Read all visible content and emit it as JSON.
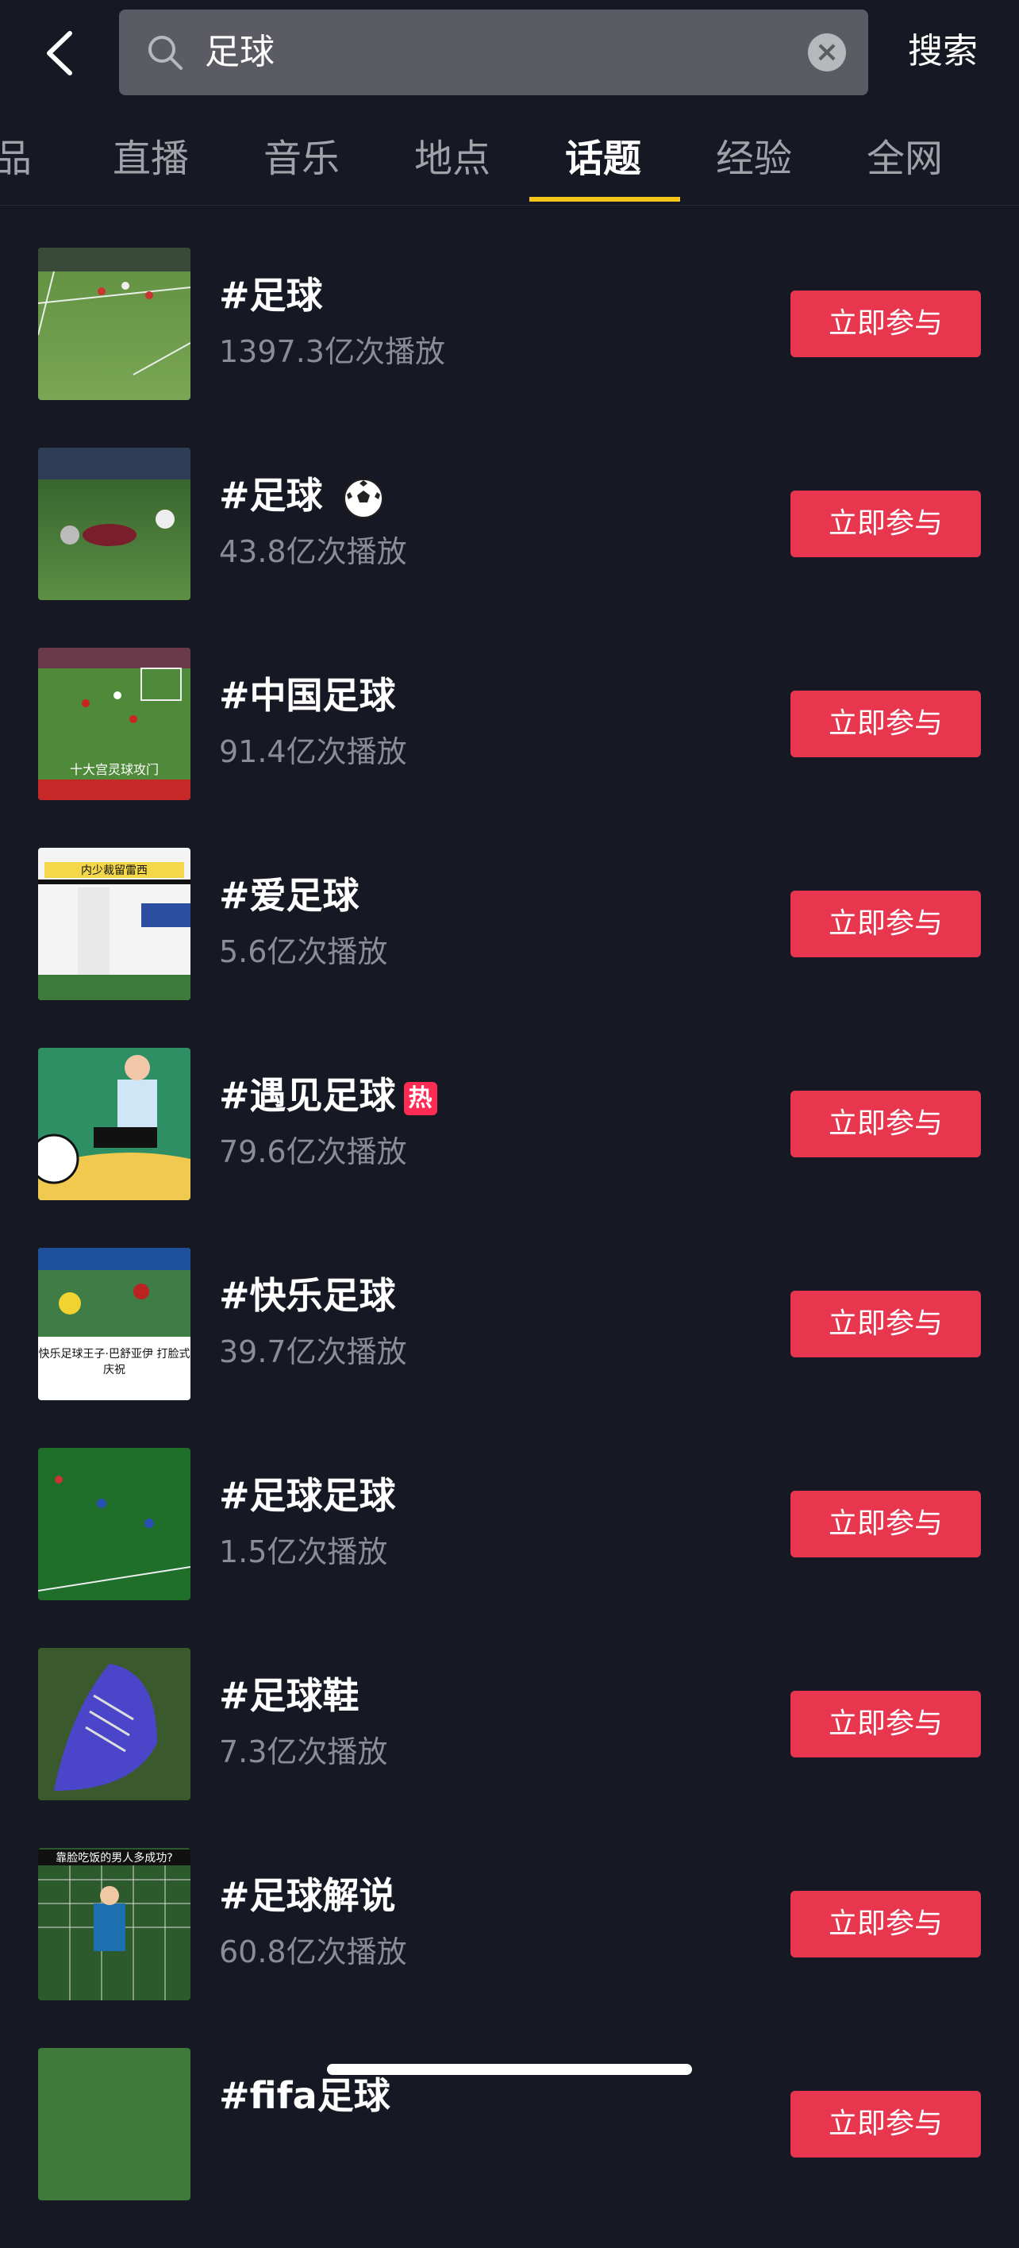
{
  "search": {
    "query": "足球",
    "button_label": "搜索"
  },
  "tabs": [
    {
      "label": "品"
    },
    {
      "label": "直播"
    },
    {
      "label": "音乐"
    },
    {
      "label": "地点"
    },
    {
      "label": "话题",
      "active": true
    },
    {
      "label": "经验"
    },
    {
      "label": "全网"
    }
  ],
  "topics": [
    {
      "title": "#足球",
      "plays": "1397.3亿次播放",
      "button": "立即参与"
    },
    {
      "title": "#足球",
      "plays": "43.8亿次播放",
      "button": "立即参与",
      "emoji": "soccer-ball"
    },
    {
      "title": "#中国足球",
      "plays": "91.4亿次播放",
      "button": "立即参与",
      "thumb_caption": "十大宫灵球攻门"
    },
    {
      "title": "#爱足球",
      "plays": "5.6亿次播放",
      "button": "立即参与",
      "thumb_caption": "内少裁留雷西"
    },
    {
      "title": "#遇见足球",
      "plays": "79.6亿次播放",
      "button": "立即参与",
      "badge": "热"
    },
    {
      "title": "#快乐足球",
      "plays": "39.7亿次播放",
      "button": "立即参与",
      "thumb_caption": "快乐足球王子·巴舒亚伊 打脸式庆祝"
    },
    {
      "title": "#足球足球",
      "plays": "1.5亿次播放",
      "button": "立即参与"
    },
    {
      "title": "#足球鞋",
      "plays": "7.3亿次播放",
      "button": "立即参与"
    },
    {
      "title": "#足球解说",
      "plays": "60.8亿次播放",
      "button": "立即参与",
      "thumb_caption": "靠脸吃饭的男人多成功?"
    },
    {
      "title": "#fifa足球",
      "plays": "",
      "button": "立即参与"
    }
  ],
  "colors": {
    "background": "#161823",
    "accent_button": "#e8364f",
    "tab_indicator": "#f5c518",
    "hot_badge": "#fe2c55"
  },
  "icons": {
    "back": "chevron-left-icon",
    "search": "search-icon",
    "clear": "clear-icon"
  }
}
